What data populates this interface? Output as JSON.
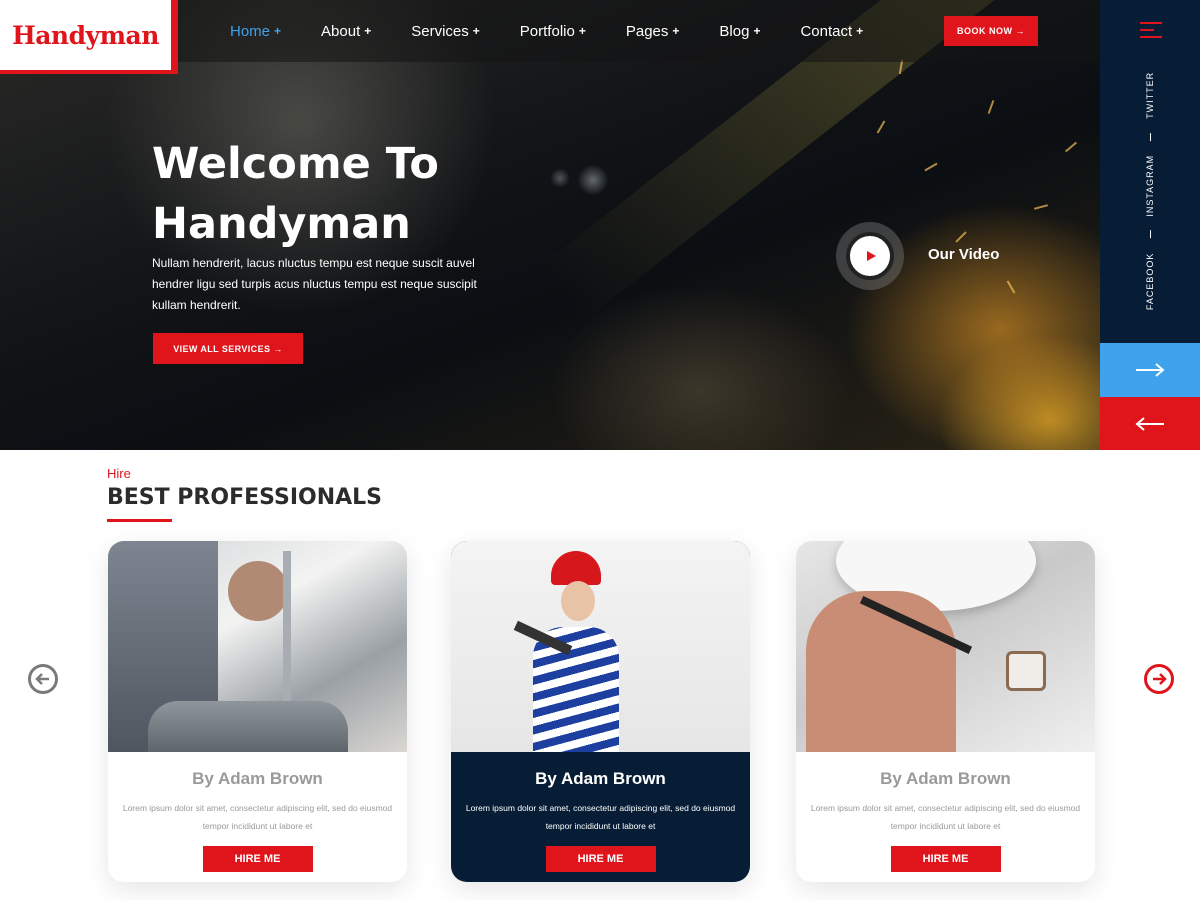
{
  "brand": {
    "logo_text": "Handyman",
    "accent": "#e0151b",
    "blue": "#3ea2ec",
    "navy": "#071d36"
  },
  "nav": {
    "items": [
      {
        "label": "Home",
        "active": true
      },
      {
        "label": "About",
        "active": false
      },
      {
        "label": "Services",
        "active": false
      },
      {
        "label": "Portfolio",
        "active": false
      },
      {
        "label": "Pages",
        "active": false
      },
      {
        "label": "Blog",
        "active": false
      },
      {
        "label": "Contact",
        "active": false
      }
    ],
    "plus": "+",
    "book_now": "BOOK NOW",
    "arrow": "→"
  },
  "hero": {
    "title_line1": "Welcome To",
    "title_line2": "Handyman",
    "description": "Nullam hendrerit, lacus nluctus tempu est neque suscit auvel hendrer ligu sed turpis acus nluctus tempu est neque suscipit kullam hendrerit.",
    "cta": "VIEW ALL SERVICES",
    "video_label": "Our Video"
  },
  "sidebar": {
    "icon": "hamburger-menu-icon",
    "social": [
      "FACEBOOK",
      "INSTAGRAM",
      "TWITTER"
    ],
    "next_icon": "arrow-right-icon",
    "prev_icon": "arrow-left-icon"
  },
  "professionals": {
    "kicker": "Hire",
    "title": "BEST PROFESSIONALS",
    "cards": [
      {
        "name": "By Adam Brown",
        "text": "Lorem ipsum dolor sit amet, consectetur adipiscing elit, sed do eiusmod tempor incididunt ut labore et",
        "button": "HIRE ME",
        "highlight": false
      },
      {
        "name": "By Adam Brown",
        "text": "Lorem ipsum dolor sit amet, consectetur adipiscing elit, sed do eiusmod tempor incididunt ut labore et",
        "button": "HIRE ME",
        "highlight": true
      },
      {
        "name": "By Adam Brown",
        "text": "Lorem ipsum dolor sit amet, consectetur adipiscing elit, sed do eiusmod tempor incididunt ut labore et",
        "button": "HIRE ME",
        "highlight": false
      }
    ]
  }
}
